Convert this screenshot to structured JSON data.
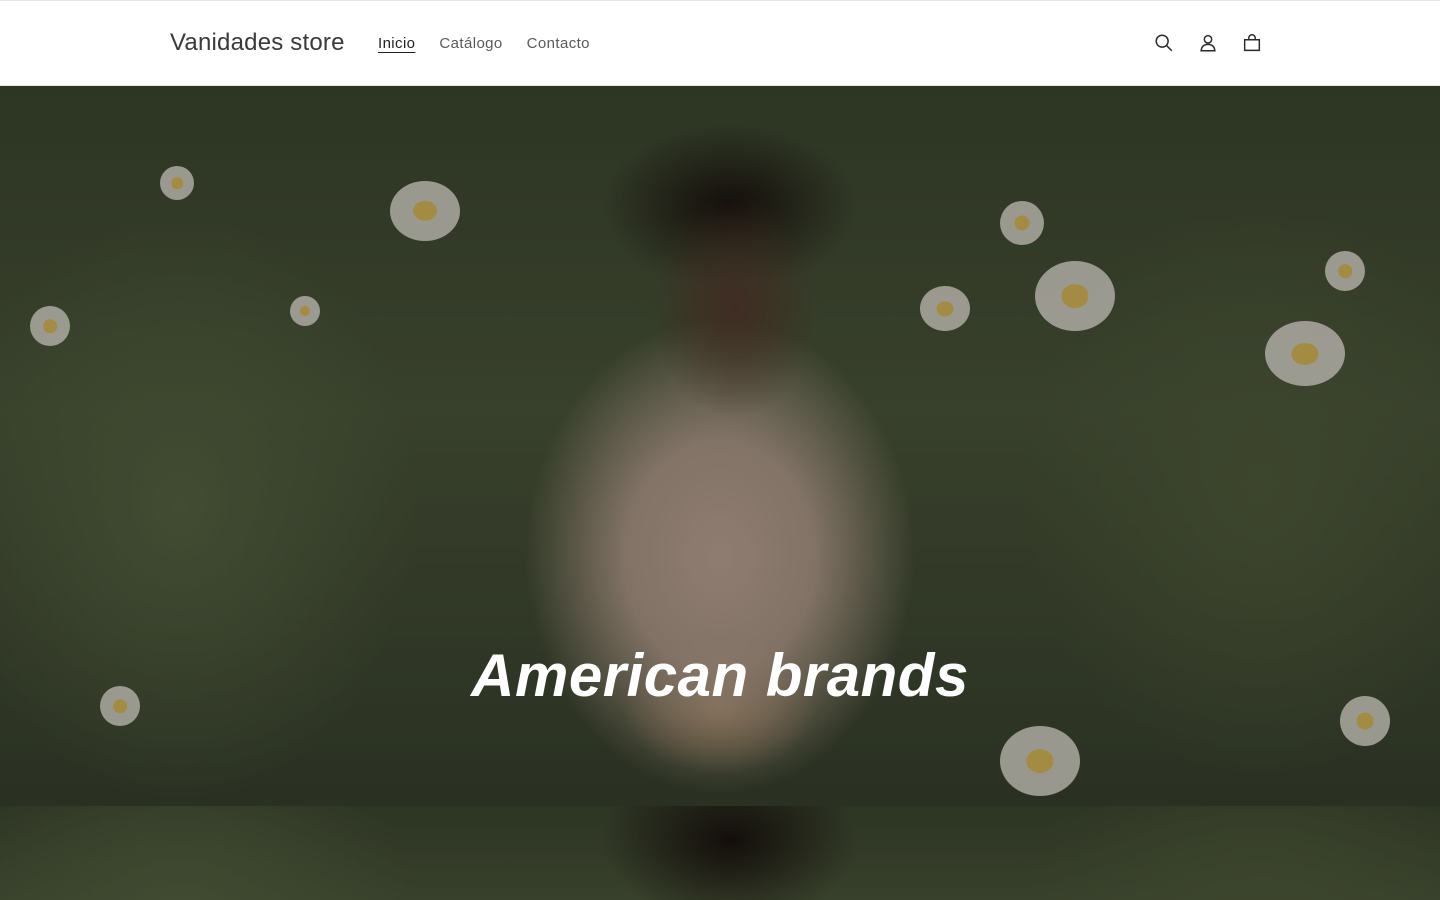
{
  "store": {
    "name": "Vanidades store"
  },
  "nav": {
    "items": [
      {
        "label": "Inicio",
        "active": true
      },
      {
        "label": "Catálogo",
        "active": false
      },
      {
        "label": "Contacto",
        "active": false
      }
    ]
  },
  "header_icons": [
    "search-icon",
    "account-icon",
    "cart-icon"
  ],
  "hero": {
    "title": "American brands",
    "image": "woman-in-flower-field-photo"
  },
  "colors": {
    "header_bg": "#ffffff",
    "text": "#121212",
    "hero_title": "#ffffff"
  }
}
